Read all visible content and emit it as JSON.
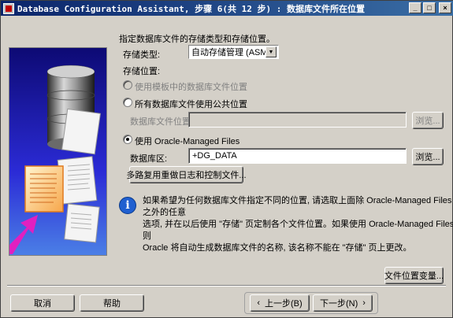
{
  "window": {
    "title": "Database Configuration Assistant, 步骤 6(共 12 步) : 数据库文件所在位置",
    "buttons": {
      "minimize": "_",
      "maximize": "□",
      "close": "×"
    }
  },
  "form": {
    "intro": "指定数据库文件的存储类型和存储位置。",
    "storage_type_label": "存储类型:",
    "storage_type_value": "自动存储管理 (ASM)",
    "storage_location_label": "存储位置:",
    "option_template": "使用模板中的数据库文件位置",
    "option_common": "所有数据库文件使用公共位置",
    "db_file_location_label": "数据库文件位置:",
    "db_file_location_value": "",
    "browse_label_1": "浏览...",
    "option_omf": "使用 Oracle-Managed Files",
    "db_area_label": "数据库区:",
    "db_area_value": "+DG_DATA",
    "browse_label_2": "浏览...",
    "multiplex_button": "多路复用重做日志和控制文件...",
    "info_line1": "如果希望为任何数据库文件指定不同的位置, 请选取上面除 Oracle-Managed Files 之外的任意",
    "info_line2": "选项, 并在以后使用 \"存储\" 页定制各个文件位置。如果使用 Oracle-Managed Files, 则",
    "info_line3": "Oracle 将自动生成数据库文件的名称, 该名称不能在 \"存储\" 页上更改。",
    "file_location_vars_button": "文件位置变量..."
  },
  "footer": {
    "cancel": "取消",
    "help": "帮助",
    "back": "上一步(B)",
    "next": "下一步(N)"
  },
  "icons": {
    "info": "info-icon",
    "database": "database-cylinder-icon"
  }
}
